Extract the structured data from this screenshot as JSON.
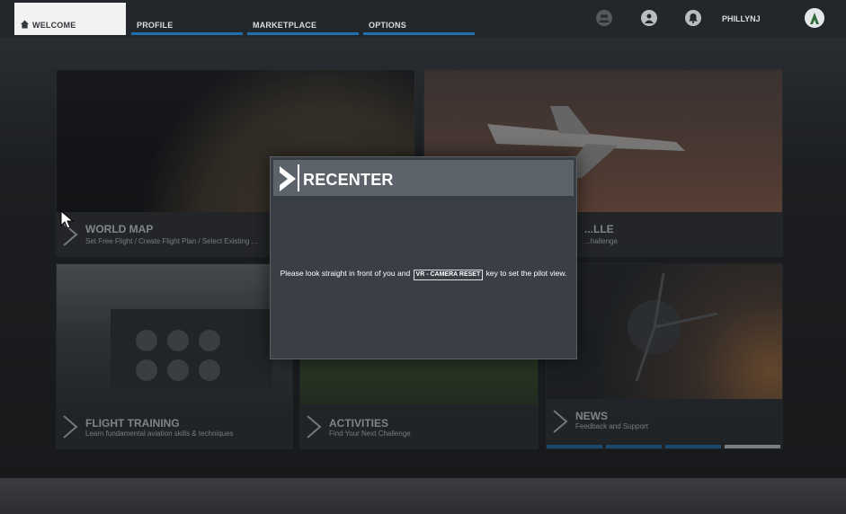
{
  "nav": {
    "tabs": [
      {
        "label": "WELCOME",
        "active": true
      },
      {
        "label": "PROFILE",
        "active": false
      },
      {
        "label": "MARKETPLACE",
        "active": false
      },
      {
        "label": "OPTIONS",
        "active": false
      }
    ],
    "icons": [
      "friends-icon",
      "user-icon",
      "notification-bell-icon"
    ],
    "username": "PHILLYNJ",
    "accent_color": "#1f6fb3"
  },
  "tiles": [
    {
      "title": "WORLD MAP",
      "subtitle": "Set Free Flight / Create Flight Plan / Select Existing ..."
    },
    {
      "title": "...LLE",
      "subtitle": "...hallenge"
    },
    {
      "title": "FLIGHT TRAINING",
      "subtitle": "Learn fundamental aviation skills & techniques"
    },
    {
      "title": "ACTIVITIES",
      "subtitle": "Find Your Next Challenge"
    },
    {
      "title": "NEWS",
      "subtitle": "Feedback and Support"
    }
  ],
  "modal": {
    "title": "RECENTER",
    "message_before": "Please look straight in front of you and",
    "key_label": "VR - CAMERA RESET",
    "message_after": "key to set the pilot view."
  }
}
